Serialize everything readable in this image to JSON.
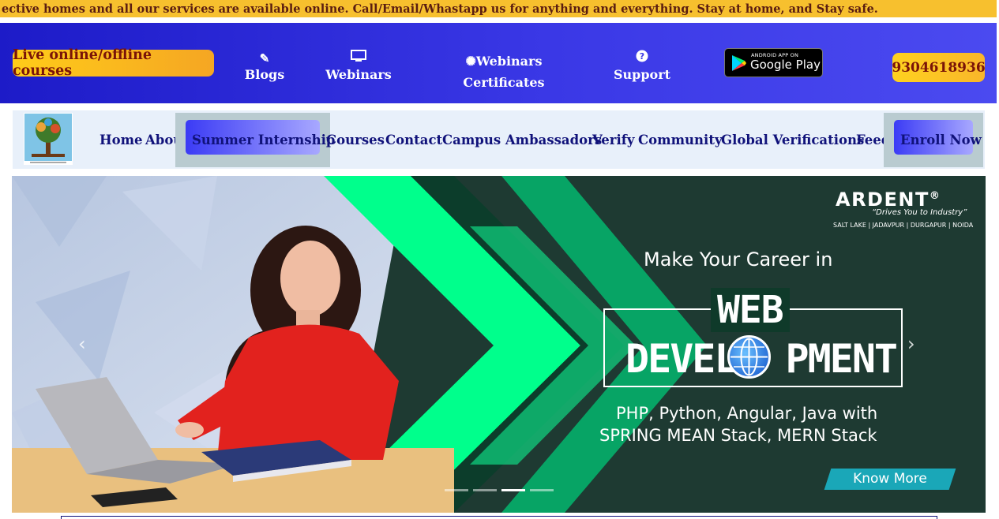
{
  "ticker": {
    "text": "ective homes and all our services are available online. Call/Email/Whastapp us for anything and everything. Stay at home, and Stay safe."
  },
  "header": {
    "courses_pill": "Live online/offline courses",
    "links": {
      "blogs": "Blogs",
      "webinars": "Webinars",
      "certificates_line1": "✺Webinars",
      "certificates_line2": "Certificates",
      "support": "Support"
    },
    "google_play": {
      "small": "ANDROID APP ON",
      "big": "Google Play"
    },
    "phone": "9304618936"
  },
  "nav": {
    "items": {
      "home": "Home",
      "about": "About",
      "summer_internship": "Summer Internship",
      "courses": "Courses",
      "contact": "Contact",
      "campus_ambassadors": "Campus Ambassadors",
      "verify": "Verify",
      "community": "Community",
      "global_verifications": "Global Verifications",
      "feeds": "Feeds",
      "enroll_now": "Enroll Now"
    }
  },
  "banner": {
    "brand": "ARDENT",
    "brand_mark": "®",
    "tagline": "“Drives You to Industry”",
    "locations": "SALT LAKE | JADAVPUR | DURGAPUR | NOIDA",
    "headline": "Make Your Career in",
    "web": "WEB",
    "devel": "DEVEL",
    "pment": "PMENT",
    "tech_line1": "PHP, Python, Angular, Java with",
    "tech_line2": "SPRING MEAN Stack, MERN Stack",
    "cta": "Know More",
    "prev": "‹",
    "next": "›",
    "active_slide": 3,
    "slide_count": 4
  },
  "colors": {
    "ticker_bg": "#f7c02e",
    "header_blue": "#3a38e6",
    "nav_text": "#10127a",
    "banner_green": "#00ff8c",
    "banner_dark": "#1e3a32"
  }
}
